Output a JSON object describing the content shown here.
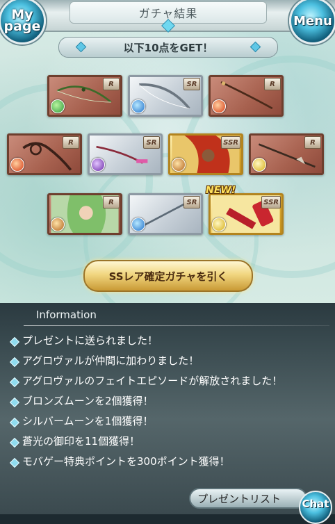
{
  "header": {
    "title": "ガチャ結果",
    "mypage_label": "My page",
    "menu_label": "Menu"
  },
  "banner": {
    "text": "以下10点をGET！"
  },
  "cards": [
    {
      "rarity": "R",
      "element": "wind",
      "kind": "bow"
    },
    {
      "rarity": "SR",
      "element": "water",
      "kind": "bow"
    },
    {
      "rarity": "R",
      "element": "fire",
      "kind": "staff"
    },
    {
      "rarity": "R",
      "element": "fire",
      "kind": "harp"
    },
    {
      "rarity": "SR",
      "element": "dark",
      "kind": "katana"
    },
    {
      "rarity": "SSR",
      "element": "earth",
      "kind": "character"
    },
    {
      "rarity": "R",
      "element": "light",
      "kind": "spear"
    },
    {
      "rarity": "R",
      "element": "earth",
      "kind": "character"
    },
    {
      "rarity": "SR",
      "element": "water",
      "kind": "spear"
    },
    {
      "rarity": "SSR",
      "element": "light",
      "kind": "item"
    }
  ],
  "new_label": "NEW!",
  "ss_button": {
    "label": "SSレア確定ガチャを引く"
  },
  "info": {
    "title": "Information",
    "items": [
      "プレゼントに送られました！",
      "アグロヴァルが仲間に加わりました！",
      "アグロヴァルのフェイトエピソードが解放されました！",
      "ブロンズムーンを2個獲得！",
      "シルバームーンを1個獲得！",
      "蒼光の御印を11個獲得！",
      "モバゲー特典ポイントを300ポイント獲得！"
    ]
  },
  "present_button": {
    "label": "プレゼントリスト"
  },
  "chat_button": {
    "label": "Chat"
  }
}
